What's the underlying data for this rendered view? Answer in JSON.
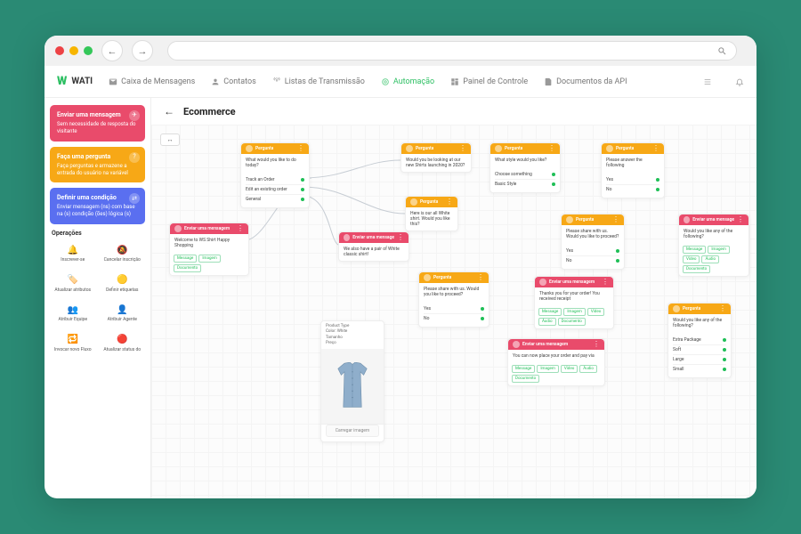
{
  "app": {
    "name": "WATI"
  },
  "nav": {
    "items": [
      {
        "label": "Caixa de Mensagens"
      },
      {
        "label": "Contatos"
      },
      {
        "label": "Listas de Transmissão"
      },
      {
        "label": "Automação",
        "active": true
      },
      {
        "label": "Painel de Controle"
      },
      {
        "label": "Documentos da API"
      }
    ]
  },
  "sidebar": {
    "cards": [
      {
        "title": "Enviar uma mensagem",
        "subtitle": "Sem necessidade de resposta do visitante"
      },
      {
        "title": "Faça uma pergunta",
        "subtitle": "Faça perguntas e armazene a entrada do usuário na variável"
      },
      {
        "title": "Definir uma condição",
        "subtitle": "Enviar mensagem (ns) com base na (s) condição (ões) lógica (s)"
      }
    ],
    "ops_title": "Operações",
    "ops": [
      {
        "icon": "🔔",
        "label": "Inscrever-se"
      },
      {
        "icon": "🔕",
        "label": "Cancelar inscrição"
      },
      {
        "icon": "🏷️",
        "label": "Atualizar atributos"
      },
      {
        "icon": "🟡",
        "label": "Definir etiquetas"
      },
      {
        "icon": "👥",
        "label": "Atribuir Equipe"
      },
      {
        "icon": "👤",
        "label": "Atribuir Agente"
      },
      {
        "icon": "🔁",
        "label": "Invocar novo Fluxo"
      },
      {
        "icon": "🔴",
        "label": "Atualizar status do"
      }
    ]
  },
  "canvas": {
    "title": "Ecommerce",
    "zoom": "↔",
    "node_labels": {
      "pergunta": "Pergunta",
      "enviar": "Enviar uma mensagem"
    },
    "chips": {
      "message": "Message",
      "imagem": "Imagem",
      "video": "Vídeo",
      "audio": "Áudio",
      "document": "Documento"
    },
    "image_caption": "Carregar imagem",
    "product_meta": {
      "l1": "Product Type",
      "l2": "Color: White",
      "l3": "Tamanho",
      "l4": "Preço"
    },
    "rows": {
      "track": "Track an Order",
      "edit": "Edit an existing order",
      "general": "General",
      "yes": "Yes",
      "no": "No",
      "soft": "Soft",
      "large": "Large",
      "small": "Small",
      "extra": "Extra Package",
      "style_a": "Choose something",
      "style_b": "Basic Style"
    },
    "body_text": {
      "welcome": "Welcome to WS Shirt Happy Shopping",
      "prompt1": "What would you like to do today?",
      "prompt2": "Would you be looking at our new Shirts launching in 2020?",
      "prompt3": "Here is our all White shirt. Would you like this?",
      "prompt4": "We also have a pair of White classic shirt!",
      "prompt5": "Please share with us. Would you like to proceed?",
      "prompt6": "What style would you like?",
      "prompt7": "Thanks you for your order! You received receipt",
      "prompt8": "Please answer the following",
      "prompt9": "Would you like any of the following?",
      "prompt10": "You can now place your order and pay via"
    }
  }
}
